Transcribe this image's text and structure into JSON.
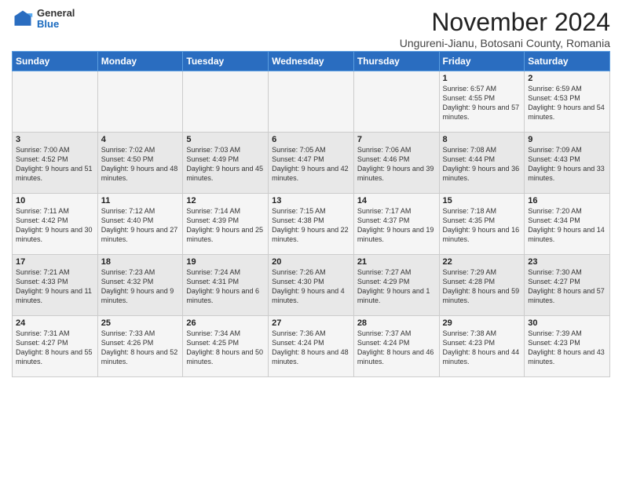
{
  "header": {
    "logo_general": "General",
    "logo_blue": "Blue",
    "title": "November 2024",
    "subtitle": "Ungureni-Jianu, Botosani County, Romania"
  },
  "days_of_week": [
    "Sunday",
    "Monday",
    "Tuesday",
    "Wednesday",
    "Thursday",
    "Friday",
    "Saturday"
  ],
  "weeks": [
    [
      {
        "day": "",
        "info": ""
      },
      {
        "day": "",
        "info": ""
      },
      {
        "day": "",
        "info": ""
      },
      {
        "day": "",
        "info": ""
      },
      {
        "day": "",
        "info": ""
      },
      {
        "day": "1",
        "info": "Sunrise: 6:57 AM\nSunset: 4:55 PM\nDaylight: 9 hours and 57 minutes."
      },
      {
        "day": "2",
        "info": "Sunrise: 6:59 AM\nSunset: 4:53 PM\nDaylight: 9 hours and 54 minutes."
      }
    ],
    [
      {
        "day": "3",
        "info": "Sunrise: 7:00 AM\nSunset: 4:52 PM\nDaylight: 9 hours and 51 minutes."
      },
      {
        "day": "4",
        "info": "Sunrise: 7:02 AM\nSunset: 4:50 PM\nDaylight: 9 hours and 48 minutes."
      },
      {
        "day": "5",
        "info": "Sunrise: 7:03 AM\nSunset: 4:49 PM\nDaylight: 9 hours and 45 minutes."
      },
      {
        "day": "6",
        "info": "Sunrise: 7:05 AM\nSunset: 4:47 PM\nDaylight: 9 hours and 42 minutes."
      },
      {
        "day": "7",
        "info": "Sunrise: 7:06 AM\nSunset: 4:46 PM\nDaylight: 9 hours and 39 minutes."
      },
      {
        "day": "8",
        "info": "Sunrise: 7:08 AM\nSunset: 4:44 PM\nDaylight: 9 hours and 36 minutes."
      },
      {
        "day": "9",
        "info": "Sunrise: 7:09 AM\nSunset: 4:43 PM\nDaylight: 9 hours and 33 minutes."
      }
    ],
    [
      {
        "day": "10",
        "info": "Sunrise: 7:11 AM\nSunset: 4:42 PM\nDaylight: 9 hours and 30 minutes."
      },
      {
        "day": "11",
        "info": "Sunrise: 7:12 AM\nSunset: 4:40 PM\nDaylight: 9 hours and 27 minutes."
      },
      {
        "day": "12",
        "info": "Sunrise: 7:14 AM\nSunset: 4:39 PM\nDaylight: 9 hours and 25 minutes."
      },
      {
        "day": "13",
        "info": "Sunrise: 7:15 AM\nSunset: 4:38 PM\nDaylight: 9 hours and 22 minutes."
      },
      {
        "day": "14",
        "info": "Sunrise: 7:17 AM\nSunset: 4:37 PM\nDaylight: 9 hours and 19 minutes."
      },
      {
        "day": "15",
        "info": "Sunrise: 7:18 AM\nSunset: 4:35 PM\nDaylight: 9 hours and 16 minutes."
      },
      {
        "day": "16",
        "info": "Sunrise: 7:20 AM\nSunset: 4:34 PM\nDaylight: 9 hours and 14 minutes."
      }
    ],
    [
      {
        "day": "17",
        "info": "Sunrise: 7:21 AM\nSunset: 4:33 PM\nDaylight: 9 hours and 11 minutes."
      },
      {
        "day": "18",
        "info": "Sunrise: 7:23 AM\nSunset: 4:32 PM\nDaylight: 9 hours and 9 minutes."
      },
      {
        "day": "19",
        "info": "Sunrise: 7:24 AM\nSunset: 4:31 PM\nDaylight: 9 hours and 6 minutes."
      },
      {
        "day": "20",
        "info": "Sunrise: 7:26 AM\nSunset: 4:30 PM\nDaylight: 9 hours and 4 minutes."
      },
      {
        "day": "21",
        "info": "Sunrise: 7:27 AM\nSunset: 4:29 PM\nDaylight: 9 hours and 1 minute."
      },
      {
        "day": "22",
        "info": "Sunrise: 7:29 AM\nSunset: 4:28 PM\nDaylight: 8 hours and 59 minutes."
      },
      {
        "day": "23",
        "info": "Sunrise: 7:30 AM\nSunset: 4:27 PM\nDaylight: 8 hours and 57 minutes."
      }
    ],
    [
      {
        "day": "24",
        "info": "Sunrise: 7:31 AM\nSunset: 4:27 PM\nDaylight: 8 hours and 55 minutes."
      },
      {
        "day": "25",
        "info": "Sunrise: 7:33 AM\nSunset: 4:26 PM\nDaylight: 8 hours and 52 minutes."
      },
      {
        "day": "26",
        "info": "Sunrise: 7:34 AM\nSunset: 4:25 PM\nDaylight: 8 hours and 50 minutes."
      },
      {
        "day": "27",
        "info": "Sunrise: 7:36 AM\nSunset: 4:24 PM\nDaylight: 8 hours and 48 minutes."
      },
      {
        "day": "28",
        "info": "Sunrise: 7:37 AM\nSunset: 4:24 PM\nDaylight: 8 hours and 46 minutes."
      },
      {
        "day": "29",
        "info": "Sunrise: 7:38 AM\nSunset: 4:23 PM\nDaylight: 8 hours and 44 minutes."
      },
      {
        "day": "30",
        "info": "Sunrise: 7:39 AM\nSunset: 4:23 PM\nDaylight: 8 hours and 43 minutes."
      }
    ]
  ]
}
